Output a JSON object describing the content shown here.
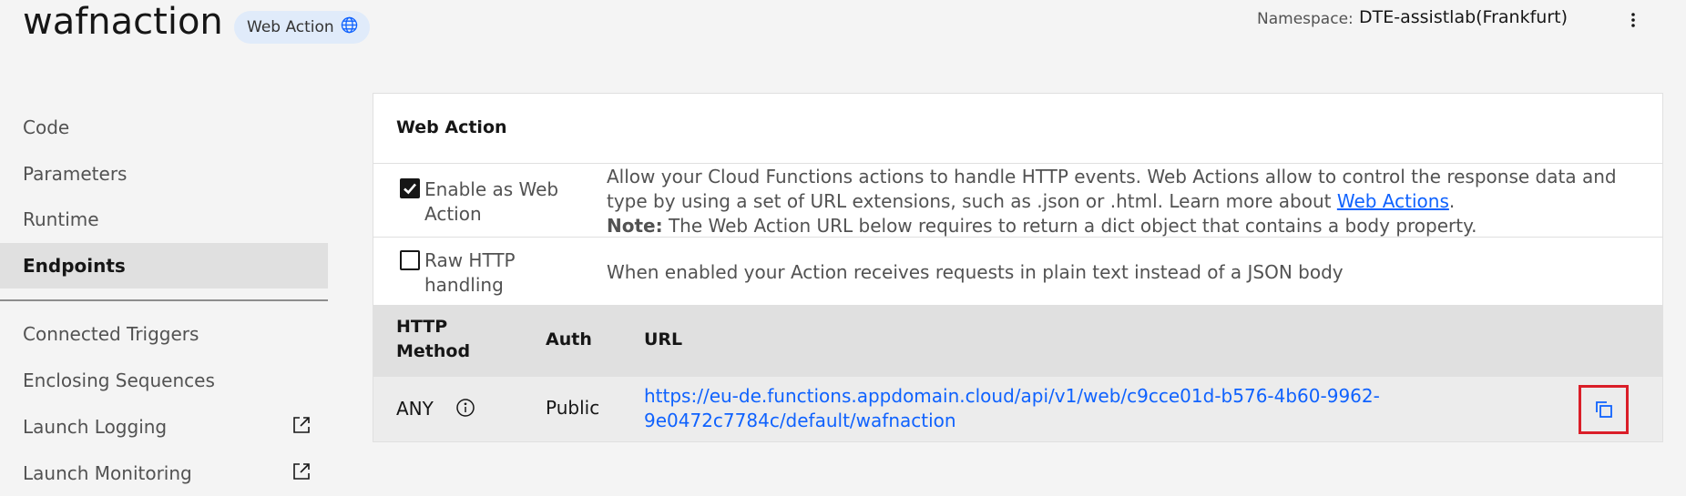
{
  "header": {
    "title": "wafnaction",
    "badge_label": "Web Action",
    "badge_icon": "globe-icon",
    "namespace_label": "Namespace:",
    "namespace_value": "DTE-assistlab(Frankfurt)",
    "menu_icon": "overflow-menu-icon"
  },
  "sidebar": {
    "items": [
      {
        "label": "Code",
        "active": false
      },
      {
        "label": "Parameters",
        "active": false
      },
      {
        "label": "Runtime",
        "active": false
      },
      {
        "label": "Endpoints",
        "active": true
      }
    ],
    "secondary_items": [
      {
        "label": "Connected Triggers",
        "external": false
      },
      {
        "label": "Enclosing Sequences",
        "external": false
      },
      {
        "label": "Launch Logging",
        "external": true
      },
      {
        "label": "Launch Monitoring",
        "external": true
      }
    ]
  },
  "web_action": {
    "title": "Web Action",
    "options": [
      {
        "label": "Enable as Web Action",
        "checked": true,
        "description_line1": "Allow your Cloud Functions actions to handle HTTP events. Web Actions allow to control the response data and type by using a set of URL extensions, such as .json or .html. Learn more about ",
        "description_link": "Web Actions",
        "description_after_link": ".",
        "note_label": "Note:",
        "note_text": " The Web Action URL below requires to return a dict object that contains a body property."
      },
      {
        "label": "Raw HTTP handling",
        "checked": false,
        "description": "When enabled your Action receives requests in plain text instead of a JSON body"
      }
    ],
    "table": {
      "headers": [
        "HTTP Method",
        "Auth",
        "URL"
      ],
      "rows": [
        {
          "method": "ANY",
          "auth": "Public",
          "url": "https://eu-de.functions.appdomain.cloud/api/v1/web/c9cce01d-b576-4b60-9962-9e0472c7784c/default/wafnaction"
        }
      ]
    }
  },
  "colors": {
    "link": "#0f62fe",
    "highlight": "#da1e28",
    "badge_bg": "#e0ebfa"
  }
}
